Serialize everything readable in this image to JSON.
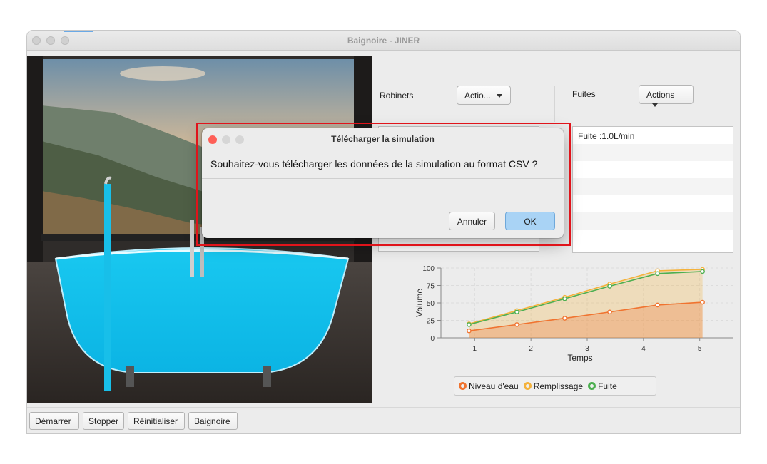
{
  "window": {
    "title": "Baignoire - JINER"
  },
  "panels": {
    "robinets": {
      "label": "Robinets",
      "button": "Actio..."
    },
    "fuites": {
      "label": "Fuites",
      "button": "Actions",
      "items": [
        "Fuite :1.0L/min",
        "",
        "",
        "",
        "",
        "",
        ""
      ]
    }
  },
  "chart_data": {
    "type": "area",
    "xlabel": "Temps",
    "ylabel": "Volume",
    "xlim": [
      0.4,
      5.6
    ],
    "ylim": [
      0,
      100
    ],
    "x_ticks": [
      "1",
      "2",
      "3",
      "4",
      "5"
    ],
    "y_ticks": [
      "0",
      "25",
      "50",
      "75",
      "100"
    ],
    "grid": true,
    "legend_position": "bottom",
    "series": [
      {
        "name": "Niveau d'eau",
        "color": "#f0732f",
        "x": [
          0.9,
          1.75,
          2.6,
          3.4,
          4.25,
          5.05
        ],
        "values": [
          10,
          19,
          28,
          37,
          47,
          51
        ]
      },
      {
        "name": "Remplissage",
        "color": "#f4b23c",
        "x": [
          0.9,
          1.75,
          2.6,
          3.4,
          4.25,
          5.05
        ],
        "values": [
          20,
          39,
          58,
          77,
          96,
          98
        ]
      },
      {
        "name": "Fuite",
        "color": "#4caf50",
        "x": [
          0.9,
          1.75,
          2.6,
          3.4,
          4.25,
          5.05
        ],
        "values": [
          19,
          37,
          56,
          74,
          92,
          95
        ]
      }
    ]
  },
  "toolbar": {
    "start": "Démarrer",
    "stop": "Stopper",
    "reset": "Réinitialiser",
    "bath": "Baignoire"
  },
  "dialog": {
    "title": "Télécharger la simulation",
    "message": "Souhaitez-vous télécharger les données de la simulation au format CSV ?",
    "cancel": "Annuler",
    "ok": "OK",
    "colors": {
      "close": "#fe5f57",
      "ok_button": "#a9d3f5"
    }
  }
}
